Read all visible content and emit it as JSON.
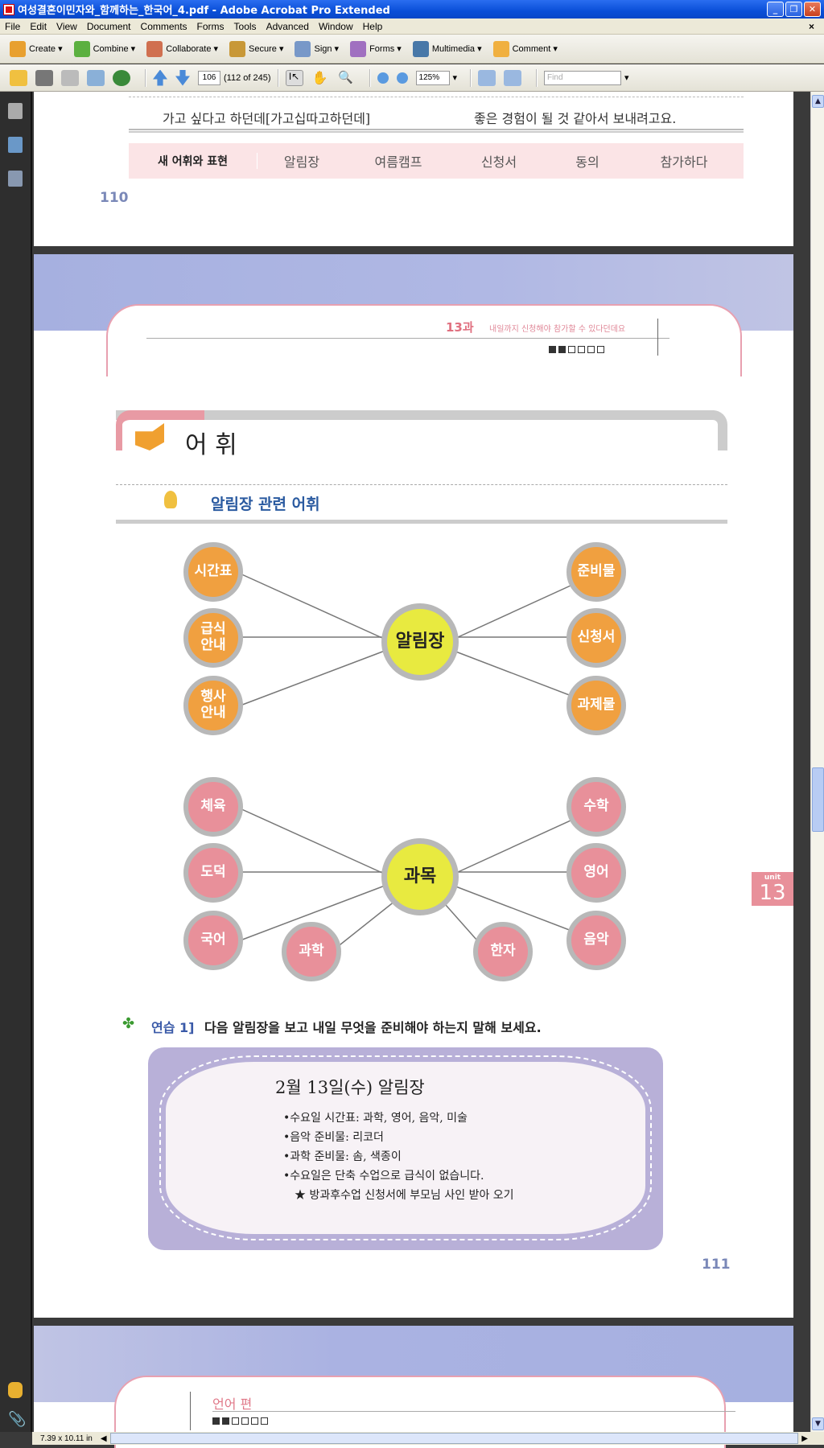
{
  "window": {
    "title": "여성결혼이민자와_함께하는_한국어_4.pdf - Adobe Acrobat Pro Extended",
    "minimize": "_",
    "restore": "❐",
    "close": "✕"
  },
  "menu": [
    "File",
    "Edit",
    "View",
    "Document",
    "Comments",
    "Forms",
    "Tools",
    "Advanced",
    "Window",
    "Help"
  ],
  "menu_close": "×",
  "toolbar1": [
    {
      "label": "Create ▾",
      "icon": "create-icon",
      "color": "#e8a030"
    },
    {
      "label": "Combine ▾",
      "icon": "combine-icon",
      "color": "#5cb040"
    },
    {
      "label": "Collaborate ▾",
      "icon": "collaborate-icon",
      "color": "#d07050"
    },
    {
      "label": "Secure ▾",
      "icon": "lock-icon",
      "color": "#c89838"
    },
    {
      "label": "Sign ▾",
      "icon": "pen-icon",
      "color": "#7898c8"
    },
    {
      "label": "Forms ▾",
      "icon": "forms-icon",
      "color": "#a070c0"
    },
    {
      "label": "Multimedia ▾",
      "icon": "multimedia-icon",
      "color": "#4878a8"
    },
    {
      "label": "Comment ▾",
      "icon": "comment-icon",
      "color": "#f0b040"
    }
  ],
  "toolbar2": {
    "page_number": "106",
    "page_count": "(112 of 245)",
    "zoom": "125%",
    "find_placeholder": "Find"
  },
  "status": {
    "page_size": "7.39 x 10.11 in"
  },
  "page110": {
    "dialog_left": "가고 싶다고 하던데[가고십따고하던데]",
    "dialog_right": "좋은 경험이 될 것 같아서 보내려고요.",
    "vocab_label": "새 어휘와 표현",
    "vocab": [
      "알림장",
      "여름캠프",
      "신청서",
      "동의",
      "참가하다"
    ],
    "page_no": "110"
  },
  "page111": {
    "lesson": "13과",
    "lesson_title": "내일까지 신청해야 참가할 수 있다던데요",
    "progress_filled": 2,
    "progress_total": 6,
    "section_title": "어 휘",
    "subsection_title": "알림장 관련 어휘",
    "map1": {
      "center": "알림장",
      "left": [
        "시간표",
        "급식\n안내",
        "행사\n안내"
      ],
      "right": [
        "준비물",
        "신청서",
        "과제물"
      ]
    },
    "map2": {
      "center": "과목",
      "left": [
        "체육",
        "도덕",
        "국어"
      ],
      "bottom": [
        "과학",
        "한자"
      ],
      "right": [
        "수학",
        "영어",
        "음악"
      ]
    },
    "unit_label": "unit",
    "unit_number": "13",
    "exercise_label": "연습 1]",
    "exercise_text": "다음 알림장을 보고 내일 무엇을 준비해야 하는지 말해 보세요.",
    "notice_title": "2월 13일(수) 알림장",
    "notice_items": [
      "•수요일 시간표: 과학, 영어, 음악, 미술",
      "•음악 준비물: 리코더",
      "•과학 준비물: 솜, 색종이",
      "•수요일은 단축 수업으로 급식이 없습니다."
    ],
    "notice_star": "★ 방과후수업 신청서에 부모님 사인 받아 오기",
    "page_no": "111"
  },
  "page112": {
    "section": "언어 편",
    "progress_filled": 2,
    "progress_total": 6
  }
}
